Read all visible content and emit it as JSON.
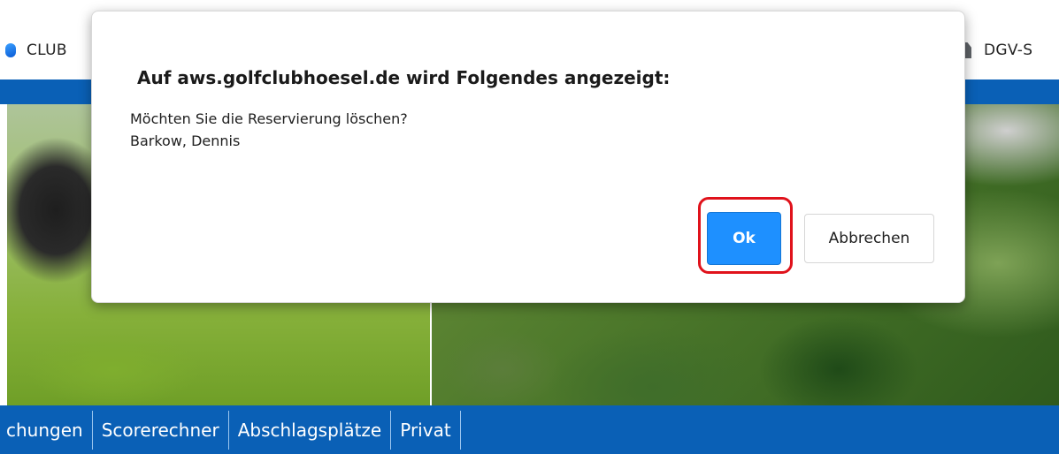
{
  "bookmarks": {
    "left_label": "CLUB",
    "left_icon": "club-icon",
    "right_label": "DGV-S",
    "right_icon": "document-icon"
  },
  "colors": {
    "brand_blue": "#0a60b6",
    "ok_blue": "#1e90ff",
    "highlight_red": "#e0121b"
  },
  "nav": {
    "items": [
      "chungen",
      "Scorerechner",
      "Abschlagsplätze",
      "Privat"
    ]
  },
  "dialog": {
    "title": "Auf aws.golfclubhoesel.de wird Folgendes angezeigt:",
    "message_line1": "Möchten Sie die Reservierung löschen?",
    "message_line2": "Barkow, Dennis",
    "ok_label": "Ok",
    "cancel_label": "Abbrechen"
  }
}
